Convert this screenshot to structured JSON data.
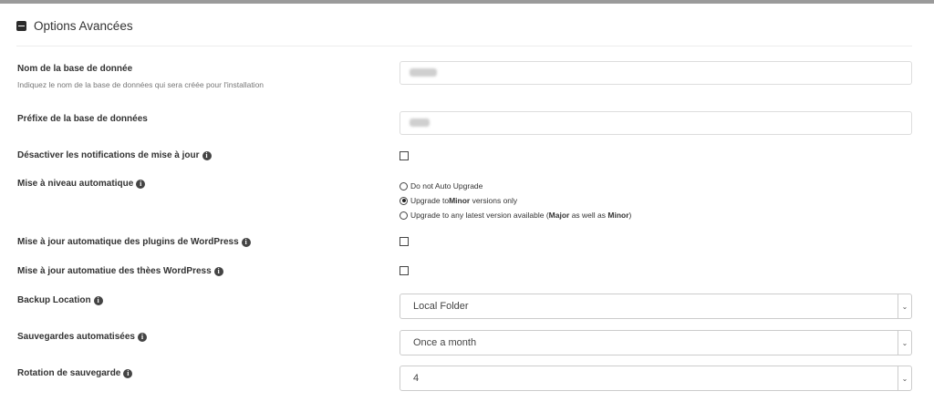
{
  "section": {
    "title": "Options Avancées",
    "icon": "collapse-icon"
  },
  "db_name": {
    "label": "Nom de la base de donnée",
    "help": "Indiquez le nom de la base de données qui sera créée pour l'installation"
  },
  "db_prefix": {
    "label": "Préfixe de la base de données"
  },
  "disable_notifications": {
    "label": "Désactiver les notifications de mise à jour",
    "checked": false
  },
  "auto_upgrade": {
    "label": "Mise à niveau automatique",
    "options": [
      {
        "text": "Do not Auto Upgrade",
        "selected": false
      },
      {
        "prefix": "Upgrade to ",
        "bold": "Minor",
        "suffix": " versions only",
        "selected": true
      },
      {
        "prefix": "Upgrade to any latest version available (",
        "bold": "Major",
        "mid": " as well as ",
        "bold2": "Minor",
        "suffix": ")",
        "selected": false
      }
    ]
  },
  "auto_plugins": {
    "label": "Mise à jour automatique des plugins de WordPress",
    "checked": false
  },
  "auto_themes": {
    "label": "Mise à jour automatiue des thèes WordPress",
    "checked": false
  },
  "backup_location": {
    "label": "Backup Location",
    "value": "Local Folder"
  },
  "auto_backups": {
    "label": "Sauvegardes automatisées",
    "value": "Once a month"
  },
  "backup_rotation": {
    "label": "Rotation de sauvegarde",
    "value": "4"
  },
  "info_glyph": "i"
}
